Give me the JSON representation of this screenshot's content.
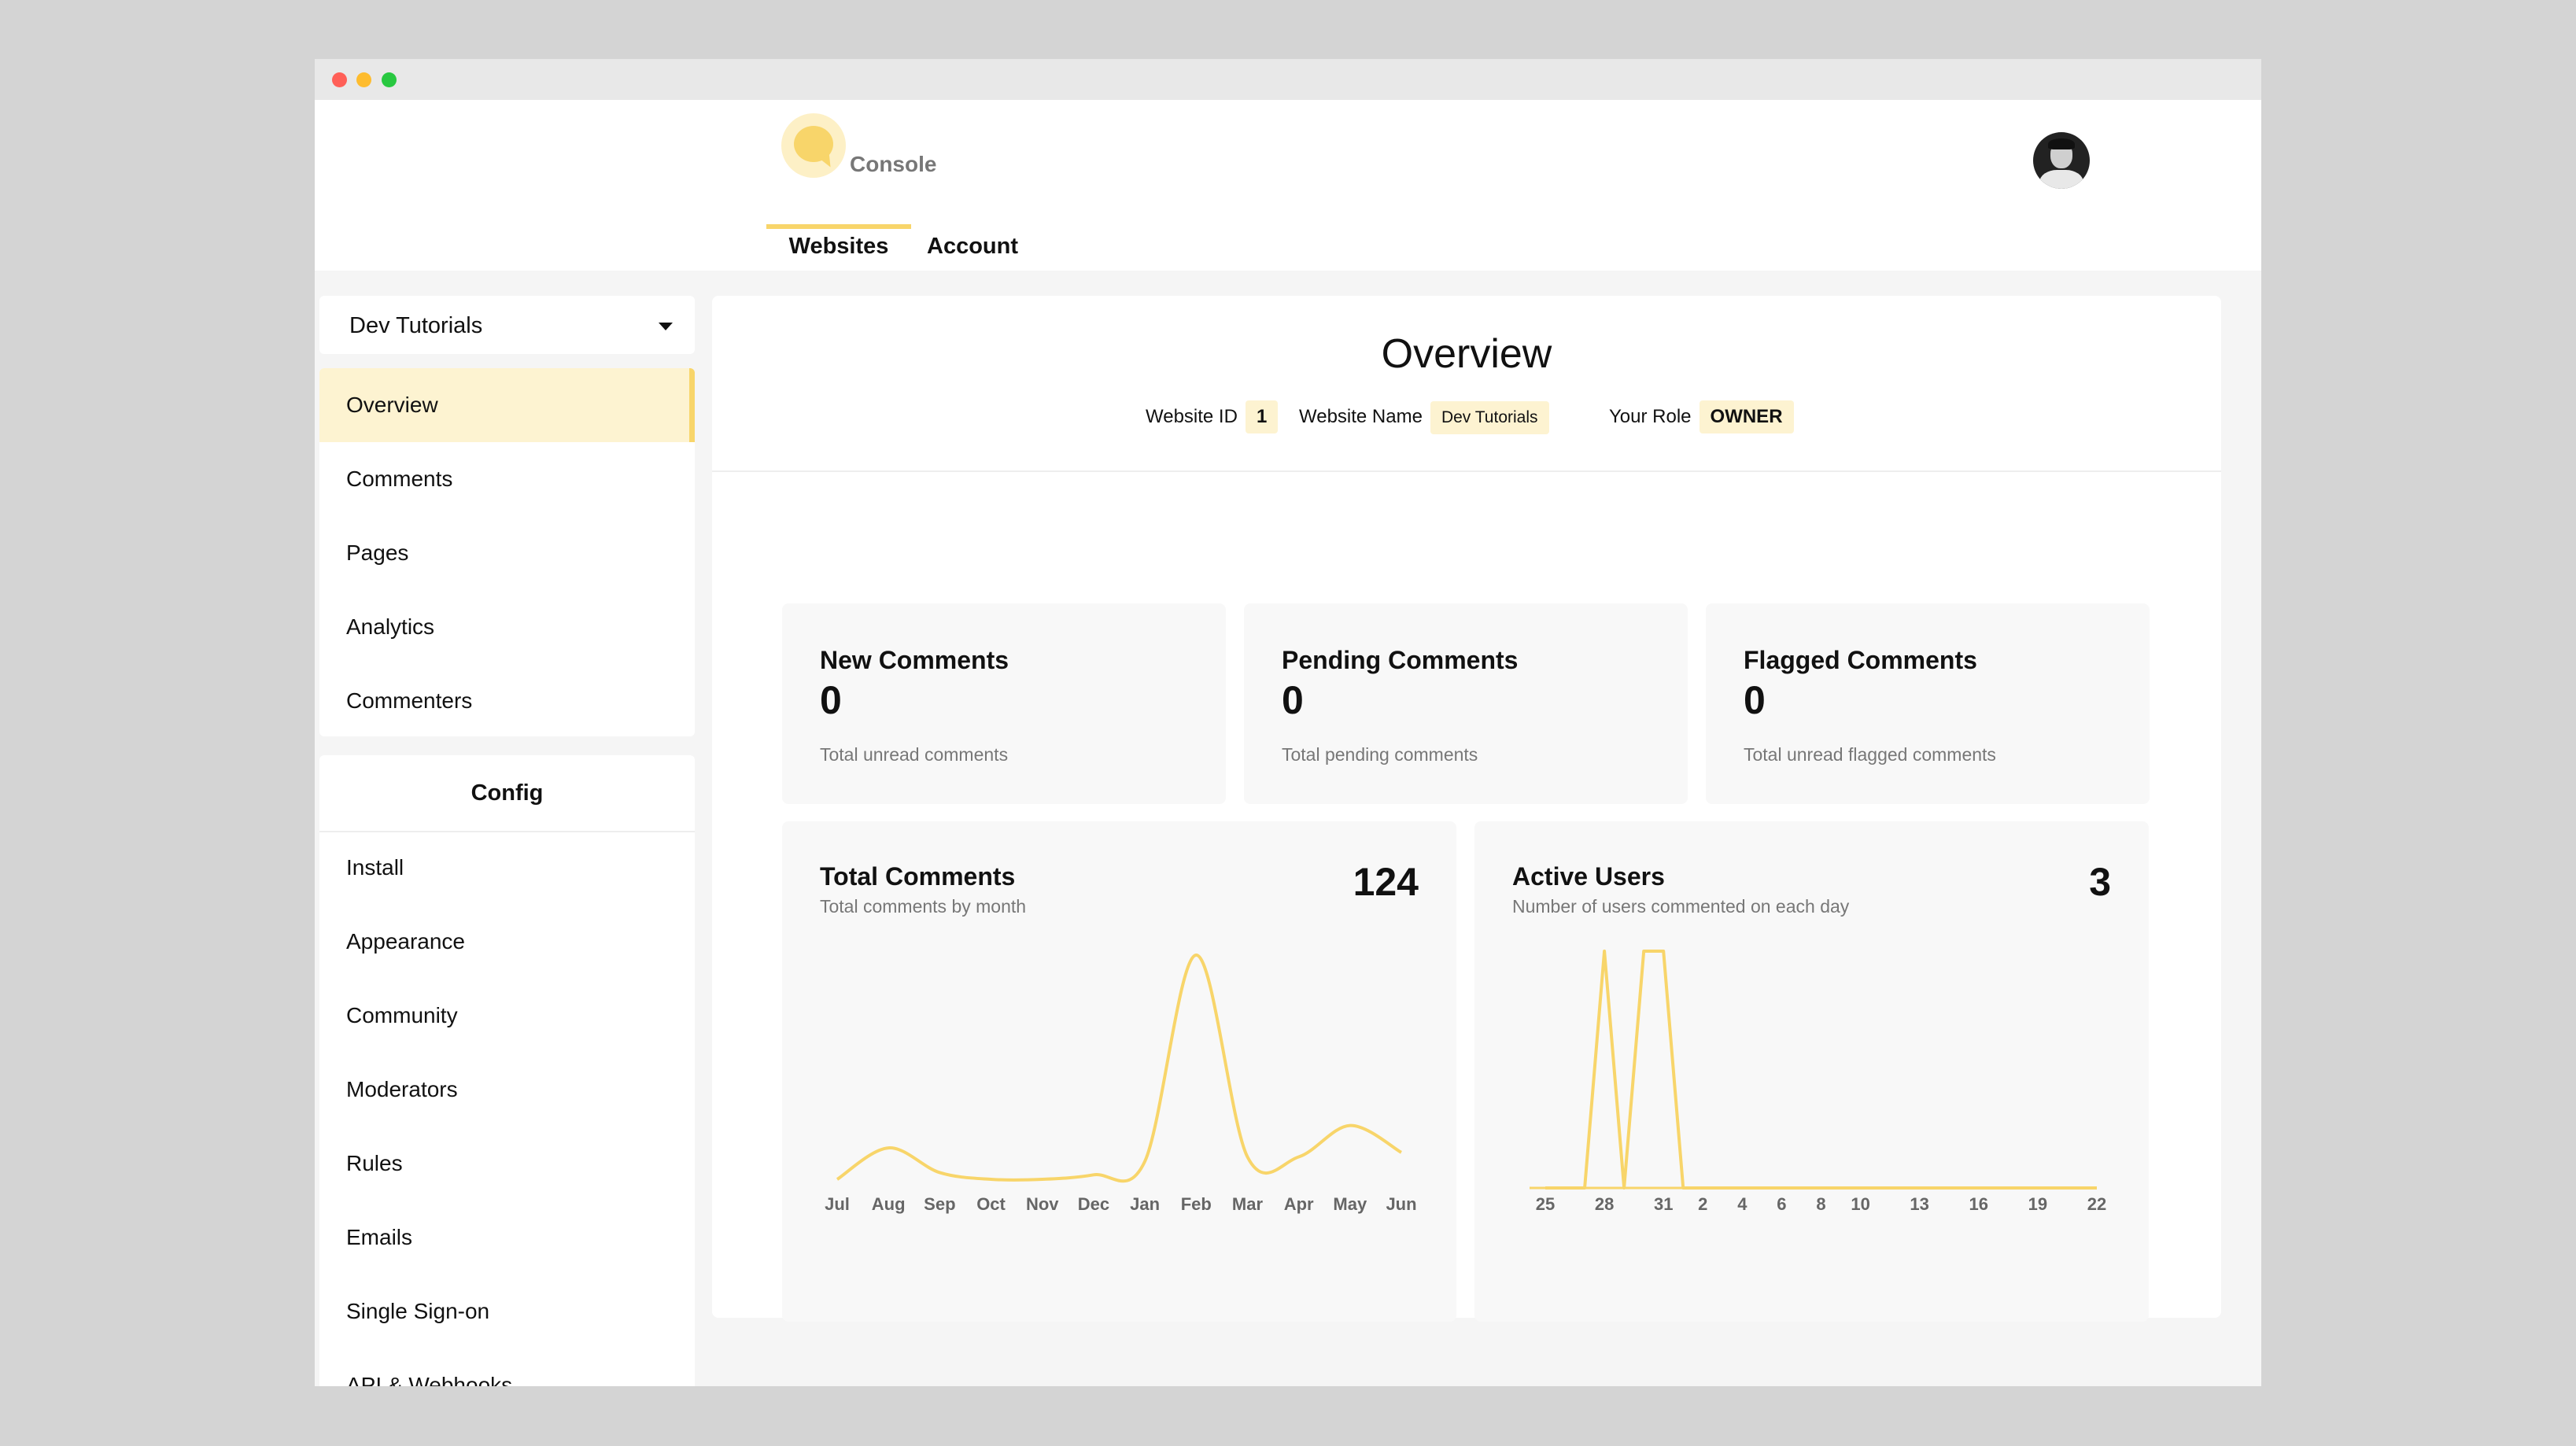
{
  "header": {
    "app_name": "Console",
    "tabs": [
      {
        "label": "Websites",
        "active": true
      },
      {
        "label": "Account",
        "active": false
      }
    ]
  },
  "sidebar": {
    "website_select": "Dev Tutorials",
    "items": [
      {
        "label": "Overview",
        "active": true
      },
      {
        "label": "Comments"
      },
      {
        "label": "Pages"
      },
      {
        "label": "Analytics"
      },
      {
        "label": "Commenters"
      }
    ],
    "config_title": "Config",
    "config_items": [
      {
        "label": "Install"
      },
      {
        "label": "Appearance"
      },
      {
        "label": "Community"
      },
      {
        "label": "Moderators"
      },
      {
        "label": "Rules"
      },
      {
        "label": "Emails"
      },
      {
        "label": "Single Sign-on"
      },
      {
        "label": "API & Webhooks"
      }
    ]
  },
  "overview": {
    "title": "Overview",
    "website_id_label": "Website ID",
    "website_id": "1",
    "website_name_label": "Website Name",
    "website_name": "Dev Tutorials",
    "role_label": "Your Role",
    "role": "OWNER"
  },
  "stats": [
    {
      "title": "New Comments",
      "value": "0",
      "subtitle": "Total unread comments"
    },
    {
      "title": "Pending Comments",
      "value": "0",
      "subtitle": "Total pending comments"
    },
    {
      "title": "Flagged Comments",
      "value": "0",
      "subtitle": "Total unread flagged comments"
    }
  ],
  "total_comments": {
    "title": "Total Comments",
    "subtitle": "Total comments by month",
    "value": "124"
  },
  "active_users": {
    "title": "Active Users",
    "subtitle": "Number of users commented on each day",
    "value": "3"
  },
  "colors": {
    "accent": "#f8d56a",
    "accent_light": "#fdf3d1"
  },
  "chart_data": [
    {
      "type": "line",
      "categories": [
        "Jul",
        "Aug",
        "Sep",
        "Oct",
        "Nov",
        "Dec",
        "Jan",
        "Feb",
        "Mar",
        "Apr",
        "May",
        "Jun"
      ],
      "values": [
        0,
        14,
        3,
        0,
        0,
        2,
        8,
        100,
        10,
        10,
        24,
        12
      ],
      "ylim": [
        0,
        100
      ]
    },
    {
      "type": "line",
      "categories": [
        "25",
        "26",
        "27",
        "28",
        "29",
        "30",
        "31",
        "1",
        "2",
        "3",
        "4",
        "5",
        "6",
        "7",
        "8",
        "9",
        "10",
        "11",
        "12",
        "13",
        "14",
        "15",
        "16",
        "17",
        "18",
        "19",
        "20",
        "21",
        "22"
      ],
      "tick_labels": [
        "25",
        "28",
        "31",
        "2",
        "4",
        "6",
        "8",
        "10",
        "13",
        "16",
        "19",
        "22"
      ],
      "values": [
        0,
        0,
        0,
        1,
        0,
        1,
        1,
        0,
        0,
        0,
        0,
        0,
        0,
        0,
        0,
        0,
        0,
        0,
        0,
        0,
        0,
        0,
        0,
        0,
        0,
        0,
        0,
        0,
        0
      ],
      "ylim": [
        0,
        1
      ]
    }
  ]
}
